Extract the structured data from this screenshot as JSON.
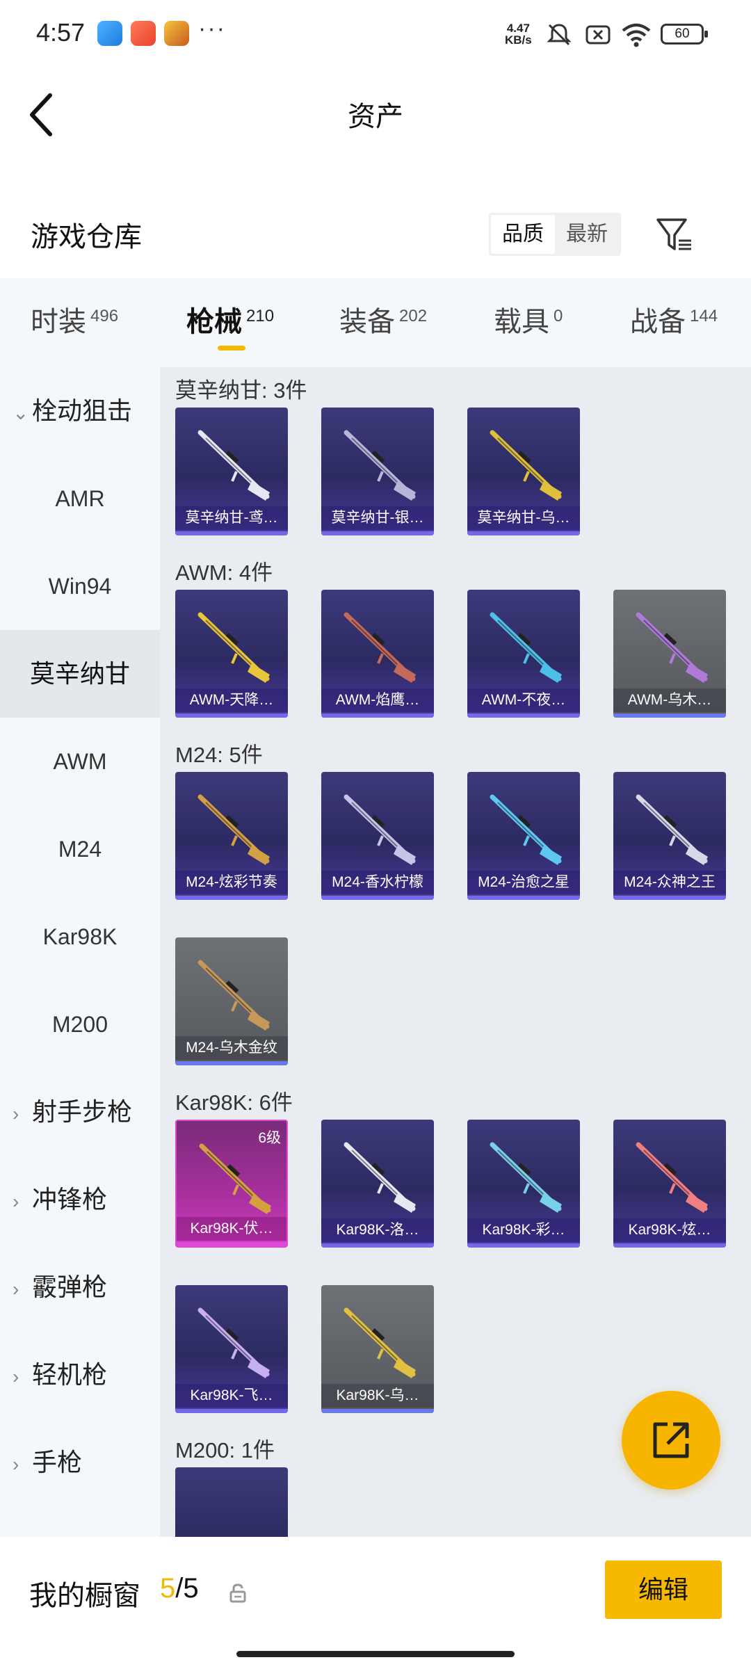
{
  "status_bar": {
    "time": "4:57",
    "speed_value": "4.47",
    "speed_unit": "KB/s",
    "battery": "60",
    "more": "···",
    "icons": [
      "app-blue-icon",
      "app-red-icon",
      "app-game-icon",
      "mute-icon",
      "no-sim-icon",
      "wifi-icon",
      "battery-icon"
    ]
  },
  "header": {
    "title": "资产"
  },
  "warehouse": {
    "title": "游戏仓库",
    "sort_options": [
      "品质",
      "最新"
    ],
    "sort_selected": "品质"
  },
  "tabs": [
    {
      "label": "时装",
      "count": "496"
    },
    {
      "label": "枪械",
      "count": "210",
      "active": true
    },
    {
      "label": "装备",
      "count": "202"
    },
    {
      "label": "载具",
      "count": "0"
    },
    {
      "label": "战备",
      "count": "144"
    }
  ],
  "sidebar": {
    "group_open": "栓动狙击",
    "items": [
      "AMR",
      "Win94",
      "莫辛纳甘",
      "AWM",
      "M24",
      "Kar98K",
      "M200"
    ],
    "active_item": "莫辛纳甘",
    "groups_closed": [
      "射手步枪",
      "冲锋枪",
      "霰弹枪",
      "轻机枪",
      "手枪"
    ]
  },
  "sections": [
    {
      "title": "莫辛纳甘: 3件",
      "items": [
        {
          "label": "莫辛纳甘-鸢…",
          "style": "purple"
        },
        {
          "label": "莫辛纳甘-银…",
          "style": "purple"
        },
        {
          "label": "莫辛纳甘-乌…",
          "style": "purple"
        }
      ]
    },
    {
      "title": "AWM: 4件",
      "items": [
        {
          "label": "AWM-天降…",
          "style": "purple"
        },
        {
          "label": "AWM-焰鹰…",
          "style": "purple"
        },
        {
          "label": "AWM-不夜…",
          "style": "purple"
        },
        {
          "label": "AWM-乌木…",
          "style": "gray"
        }
      ]
    },
    {
      "title": "M24: 5件",
      "items": [
        {
          "label": "M24-炫彩节奏",
          "style": "purple"
        },
        {
          "label": "M24-香水柠檬",
          "style": "purple"
        },
        {
          "label": "M24-治愈之星",
          "style": "purple"
        },
        {
          "label": "M24-众神之王",
          "style": "purple"
        },
        {
          "label": "M24-乌木金纹",
          "style": "gray"
        }
      ]
    },
    {
      "title": "Kar98K: 6件",
      "items": [
        {
          "label": "Kar98K-伏…",
          "style": "pink",
          "level": "6级"
        },
        {
          "label": "Kar98K-洛…",
          "style": "purple"
        },
        {
          "label": "Kar98K-彩…",
          "style": "purple"
        },
        {
          "label": "Kar98K-炫…",
          "style": "purple"
        },
        {
          "label": "Kar98K-飞…",
          "style": "purple"
        },
        {
          "label": "Kar98K-乌…",
          "style": "gray"
        }
      ]
    },
    {
      "title": "M200: 1件",
      "items": []
    }
  ],
  "fab": {
    "icon": "share-external-icon"
  },
  "bottom_bar": {
    "showcase_label": "我的橱窗",
    "showcase_used": "5",
    "showcase_separator": "/",
    "showcase_total": "5",
    "lock_icon": "lock-icon",
    "edit_label": "编辑"
  },
  "colors": {
    "accent": "#f7b800",
    "card_purple": "#2c2a62",
    "card_gray": "#55585d",
    "card_pink": "#a8309e"
  }
}
